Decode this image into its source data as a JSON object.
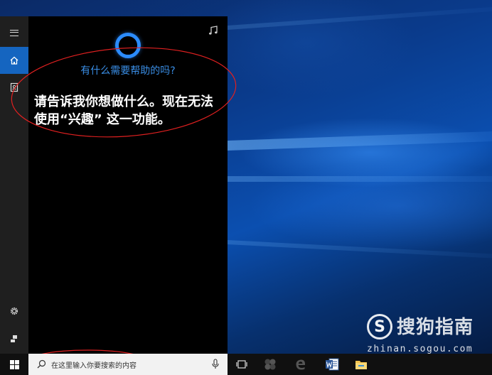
{
  "cortana": {
    "help_prompt": "有什么需要帮助的吗?",
    "message": "请告诉我你想做什么。现在无法使用“兴趣” 这一功能。"
  },
  "search": {
    "placeholder": "在这里输入你要搜索的内容"
  },
  "watermark": {
    "logo_glyph": "S",
    "brand": "搜狗指南",
    "url": "zhinan.sogou.com"
  },
  "rail": {
    "items": [
      "menu-icon",
      "home-icon",
      "notebook-icon",
      "settings-icon",
      "feedback-icon"
    ]
  },
  "taskbar": {
    "icons": [
      "windows-start-icon",
      "task-view-icon",
      "app-icon",
      "edge-icon",
      "word-icon",
      "file-explorer-icon"
    ]
  },
  "colors": {
    "accent": "#1565c0",
    "cortana_ring": "#2b8cff",
    "help_text": "#3a8ee6",
    "annotation": "#e02020"
  }
}
